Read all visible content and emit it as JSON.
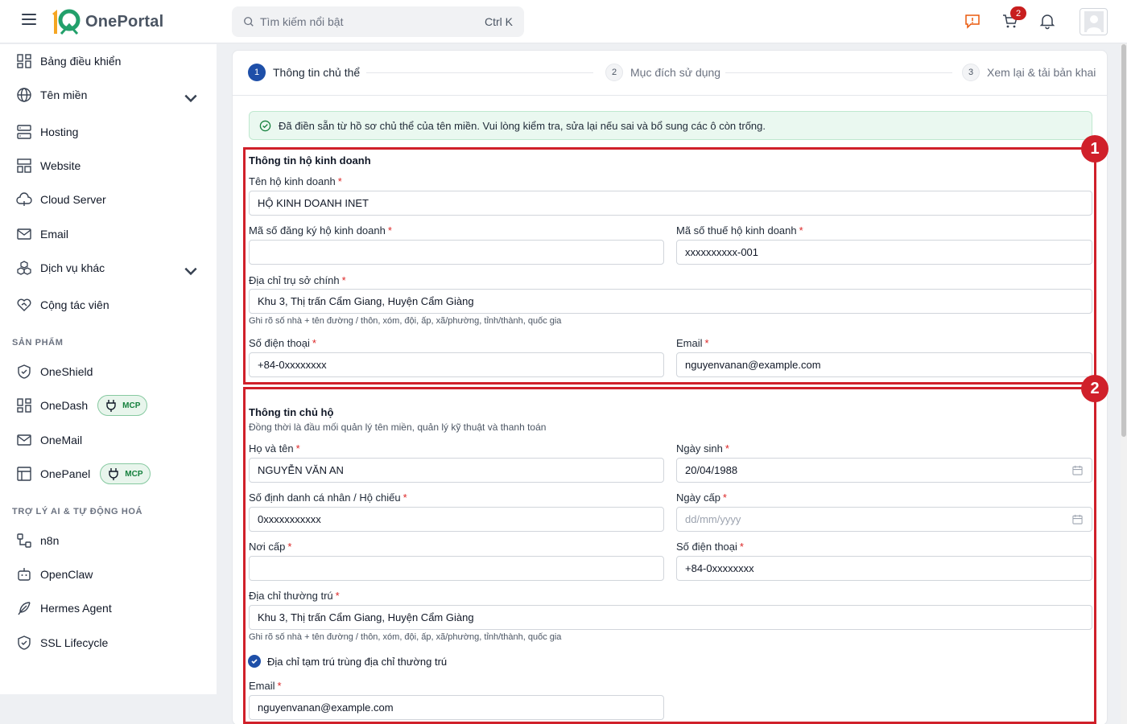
{
  "header": {
    "app_name": "OnePortal",
    "search_placeholder": "Tìm kiếm nổi bật",
    "search_shortcut": "Ctrl K",
    "cart_count": "2"
  },
  "sidebar": {
    "items": [
      {
        "label": "Bảng điều khiển"
      },
      {
        "label": "Tên miền"
      },
      {
        "label": "Hosting"
      },
      {
        "label": "Website"
      },
      {
        "label": "Cloud Server"
      },
      {
        "label": "Email"
      },
      {
        "label": "Dịch vụ khác"
      },
      {
        "label": "Cộng tác viên"
      }
    ],
    "section_products": "SẢN PHẨM",
    "products": [
      {
        "label": "OneShield"
      },
      {
        "label": "OneDash",
        "badge": "MCP"
      },
      {
        "label": "OneMail"
      },
      {
        "label": "OnePanel",
        "badge": "MCP"
      }
    ],
    "section_ai": "TRỢ LÝ AI & TỰ ĐỘNG HOÁ",
    "ai_items": [
      {
        "label": "n8n"
      },
      {
        "label": "OpenClaw"
      },
      {
        "label": "Hermes Agent"
      },
      {
        "label": "SSL Lifecycle"
      }
    ]
  },
  "stepper": {
    "steps": [
      {
        "num": "1",
        "label": "Thông tin chủ thể"
      },
      {
        "num": "2",
        "label": "Mục đích sử dụng"
      },
      {
        "num": "3",
        "label": "Xem lại & tải bản khai"
      }
    ]
  },
  "notice": "Đã điền sẵn từ hồ sơ chủ thể của tên miền. Vui lòng kiểm tra, sửa lại nếu sai và bổ sung các ô còn trống.",
  "business": {
    "title": "Thông tin hộ kinh doanh",
    "name_label": "Tên hộ kinh doanh",
    "name_value": "HỘ KINH DOANH INET",
    "reg_label": "Mã số đăng ký hộ kinh doanh",
    "reg_value": "",
    "tax_label": "Mã số thuế hộ kinh doanh",
    "tax_value": "xxxxxxxxxx-001",
    "address_label": "Địa chỉ trụ sở chính",
    "address_value": "Khu 3, Thị trấn Cẩm Giang, Huyện Cẩm Giàng",
    "address_hint": "Ghi rõ số nhà + tên đường / thôn, xóm, đội, ấp, xã/phường, tỉnh/thành, quốc gia",
    "phone_label": "Số điện thoại",
    "phone_value": "+84-0xxxxxxxx",
    "email_label": "Email",
    "email_value": "nguyenvanan@example.com"
  },
  "owner": {
    "title": "Thông tin chủ hộ",
    "subtitle": "Đồng thời là đầu mối quản lý tên miền, quản lý kỹ thuật và thanh toán",
    "fullname_label": "Họ và tên",
    "fullname_value": "NGUYỄN VĂN AN",
    "dob_label": "Ngày sinh",
    "dob_value": "20/04/1988",
    "id_label": "Số định danh cá nhân / Hộ chiếu",
    "id_value": "0xxxxxxxxxxx",
    "issue_date_label": "Ngày cấp",
    "issue_date_placeholder": "dd/mm/yyyy",
    "issue_place_label": "Nơi cấp",
    "issue_place_value": "",
    "phone_label": "Số điện thoại",
    "phone_value": "+84-0xxxxxxxx",
    "address_label": "Địa chỉ thường trú",
    "address_value": "Khu 3, Thị trấn Cẩm Giang, Huyện Cẩm Giàng",
    "address_hint": "Ghi rõ số nhà + tên đường / thôn, xóm, đội, ấp, xã/phường, tỉnh/thành, quốc gia",
    "same_address_label": "Địa chỉ tạm trú trùng địa chỉ thường trú",
    "same_address_checked": true,
    "email_label": "Email",
    "email_value": "nguyenvanan@example.com"
  },
  "required_mark": "*",
  "annotations": [
    "1",
    "2"
  ],
  "colors": {
    "primary": "#1e4fa8",
    "annotation_red": "#d0202a",
    "notice_bg": "#eaf8f0",
    "mcp_green": "#15803d"
  }
}
